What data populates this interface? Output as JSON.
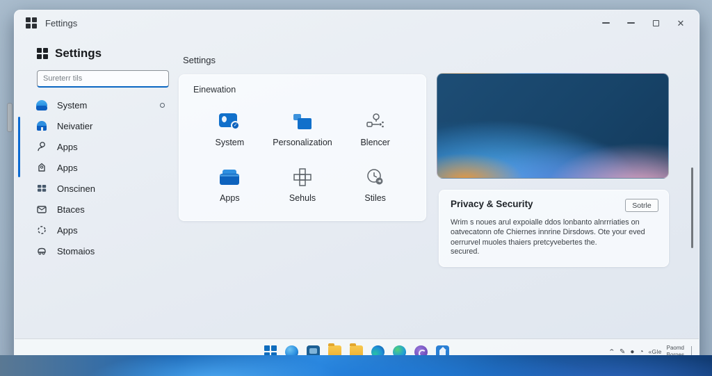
{
  "window": {
    "title": "Fettings",
    "controls": {
      "close_glyph": "✕"
    }
  },
  "sidebar": {
    "header": "Settings",
    "search_placeholder": "Sureterr tils",
    "items": [
      {
        "label": "System",
        "icon": "system-icon",
        "trailing": "ring"
      },
      {
        "label": "Neivatier",
        "icon": "home-icon"
      },
      {
        "label": "Apps",
        "icon": "person-icon"
      },
      {
        "label": "Apps",
        "icon": "tag-icon"
      },
      {
        "label": "Onscinen",
        "icon": "grid-squares-icon"
      },
      {
        "label": "Btaces",
        "icon": "mail-icon"
      },
      {
        "label": "Apps",
        "icon": "dashed-gear-icon"
      },
      {
        "label": "Stomaios",
        "icon": "device-icon"
      }
    ]
  },
  "main": {
    "heading": "Settings",
    "card_title": "Einewation",
    "tiles": [
      {
        "label": "System",
        "icon": "laptop-check-icon",
        "style": "blue"
      },
      {
        "label": "Personalization",
        "icon": "monitor-icon",
        "style": "blue"
      },
      {
        "label": "Blencer",
        "icon": "devices-link-icon",
        "style": "gray"
      },
      {
        "label": "Apps",
        "icon": "briefcase-icon",
        "style": "blue"
      },
      {
        "label": "Sehuls",
        "icon": "grid-icon",
        "style": "gray"
      },
      {
        "label": "Stiles",
        "icon": "clock-badge-icon",
        "style": "gray"
      }
    ]
  },
  "right_panel": {
    "hero": "windows-bloom-wallpaper",
    "privacy": {
      "title": "Privacy & Security",
      "button_label": "Sotrle",
      "body": "Wrim s noues arul expoialle ddos lonbanto alnrrriaties on oatvecatonn ofe Chiernes innrine Dirsdows. Ote your eved oerrurvel muoles thaiers pretcyvebertes the.",
      "body2": "secured."
    }
  },
  "taskbar": {
    "icons": [
      "windows-logo",
      "edge-blue",
      "task-view",
      "folder",
      "folder",
      "edge-teal",
      "edge-green",
      "purple-app",
      "store"
    ],
    "tray": {
      "chevron_glyph": "⌃",
      "pen_glyph": "✎",
      "dot_glyph": "●",
      "globe_glyph": "◔",
      "lang": "«Gle",
      "clock_line1": "Paomd",
      "clock_line2": "Bornes"
    }
  },
  "colors": {
    "accent_blue": "#0b6ad2",
    "tile_blue": "#1170cb",
    "window_bg": "#e9eef4",
    "desktop_bg": "#a6b9ca",
    "hero_navy": "#1a4668"
  }
}
